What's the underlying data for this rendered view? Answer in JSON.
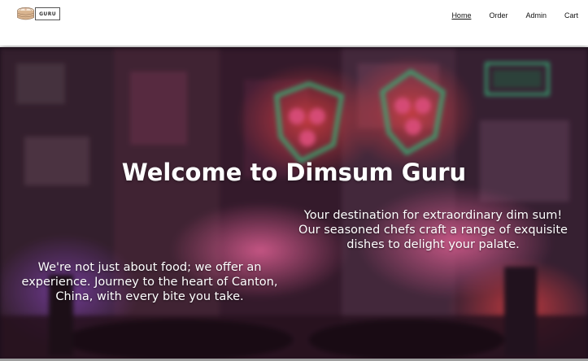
{
  "brand": {
    "logo_text": "GURU"
  },
  "nav": {
    "items": [
      {
        "label": "Home",
        "active": true
      },
      {
        "label": "Order",
        "active": false
      },
      {
        "label": "Admin",
        "active": false
      },
      {
        "label": "Cart",
        "active": false
      }
    ]
  },
  "hero": {
    "title": "Welcome to Dimsum Guru",
    "tagline": "Your destination for extraordinary dim sum! Our seasoned chefs craft a range of exquisite dishes to delight your palate.",
    "experience": "We're not just about food; we offer an experience. Journey to the heart of Canton, China, with every bite you take."
  },
  "colors": {
    "nav_bg": "#ffffff",
    "hero_text": "#ffffff",
    "neon_green": "#3fd18a",
    "neon_pink": "#ff3d8a"
  }
}
